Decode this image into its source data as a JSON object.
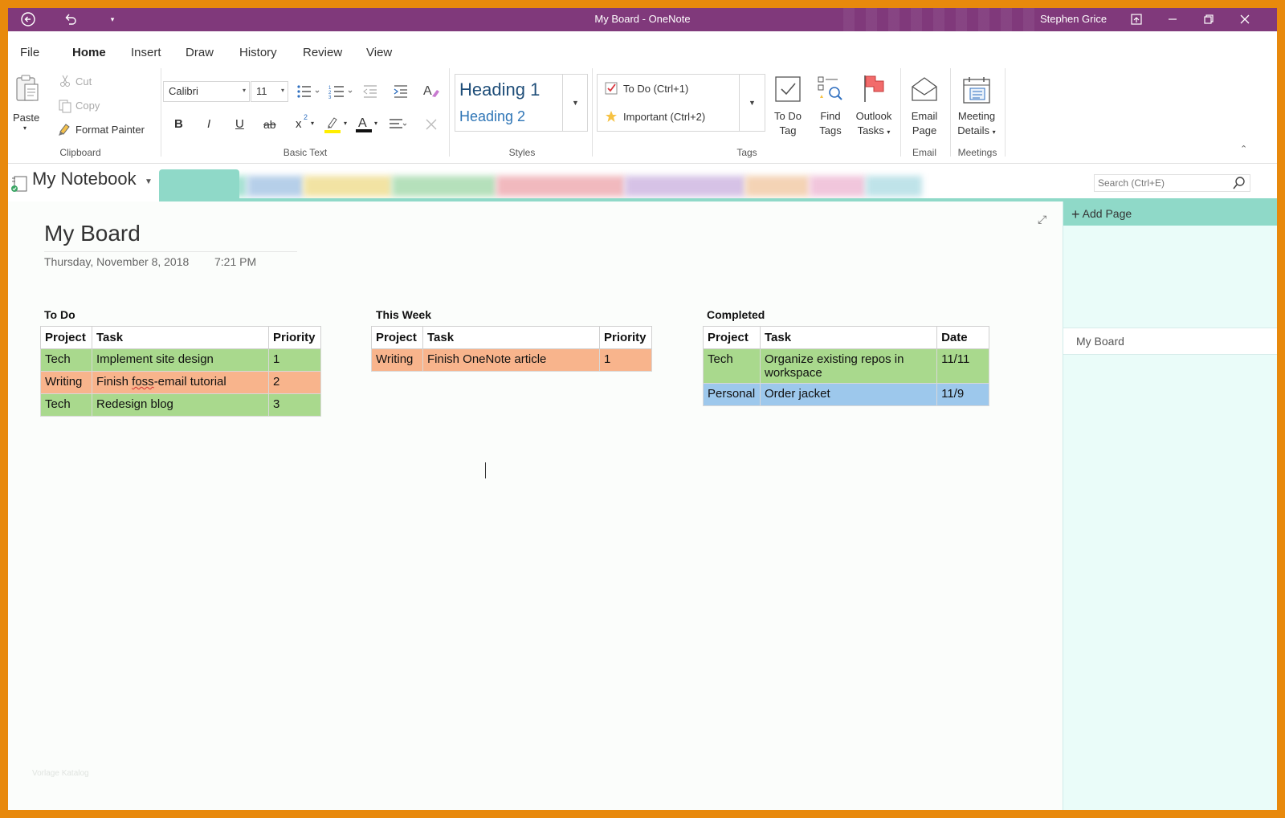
{
  "window": {
    "title": "My Board  -  OneNote",
    "user": "Stephen Grice"
  },
  "menu": {
    "tabs": [
      "File",
      "Home",
      "Insert",
      "Draw",
      "History",
      "Review",
      "View"
    ],
    "active": "Home"
  },
  "ribbon": {
    "clipboard": {
      "paste": "Paste",
      "cut": "Cut",
      "copy": "Copy",
      "format_painter": "Format Painter",
      "group": "Clipboard"
    },
    "basic_text": {
      "font": "Calibri",
      "size": "11",
      "group": "Basic Text",
      "bold": "B",
      "italic": "I",
      "underline": "U",
      "strike": "ab",
      "superscript": "x"
    },
    "styles": {
      "heading1": "Heading 1",
      "heading2": "Heading 2",
      "group": "Styles"
    },
    "tags": {
      "todo": "To Do (Ctrl+1)",
      "important": "Important (Ctrl+2)",
      "todo_tag_1": "To Do",
      "todo_tag_2": "Tag",
      "find_tags_1": "Find",
      "find_tags_2": "Tags",
      "outlook_1": "Outlook",
      "outlook_2": "Tasks",
      "group": "Tags"
    },
    "email": {
      "label_1": "Email",
      "label_2": "Page",
      "group": "Email"
    },
    "meetings": {
      "label_1": "Meeting",
      "label_2": "Details",
      "group": "Meetings"
    }
  },
  "notebook": {
    "name": "My Notebook",
    "search_placeholder": "Search (Ctrl+E)"
  },
  "page": {
    "title": "My Board",
    "date": "Thursday, November 8, 2018",
    "time": "7:21 PM",
    "watermark": "Vorlage Katalog"
  },
  "boards": {
    "todo": {
      "heading": "To Do",
      "columns": [
        "Project",
        "Task",
        "Priority"
      ],
      "rows": [
        {
          "project": "Tech",
          "task_pre": "Implement site design",
          "task_err": "",
          "task_post": "",
          "priority": "1",
          "color": "green"
        },
        {
          "project": "Writing",
          "task_pre": "Finish ",
          "task_err": "foss",
          "task_post": "-email tutorial",
          "priority": "2",
          "color": "orange"
        },
        {
          "project": "Tech",
          "task_pre": "Redesign blog",
          "task_err": "",
          "task_post": "",
          "priority": "3",
          "color": "green"
        }
      ]
    },
    "week": {
      "heading": "This Week",
      "columns": [
        "Project",
        "Task",
        "Priority"
      ],
      "rows": [
        {
          "project": "Writing",
          "task": "Finish OneNote article",
          "priority": "1",
          "color": "orange"
        }
      ]
    },
    "completed": {
      "heading": "Completed",
      "columns": [
        "Project",
        "Task",
        "Date"
      ],
      "rows": [
        {
          "project": "Tech",
          "task": "Organize existing repos in workspace",
          "date": "11/11",
          "color": "green"
        },
        {
          "project": "Personal",
          "task": "Order jacket",
          "date": "11/9",
          "color": "blue"
        }
      ]
    }
  },
  "pages_pane": {
    "add_page": "Add Page",
    "items": [
      "My Board"
    ]
  },
  "colors": {
    "onenote_purple": "#80397b",
    "section_teal": "#8fd9c8",
    "green": "#a9d98d",
    "orange": "#f8b48c",
    "blue": "#9dc8ec",
    "frame_orange": "#e8890c"
  },
  "icons": [
    "back-arrow-icon",
    "undo-icon",
    "quick-access-dropdown-icon",
    "fullscreen-icon",
    "minimize-icon",
    "restore-icon",
    "close-icon",
    "paste-icon",
    "cut-icon",
    "copy-icon",
    "format-painter-icon",
    "bullets-icon",
    "numbering-icon",
    "outdent-icon",
    "indent-icon",
    "clear-formatting-icon",
    "highlight-icon",
    "font-color-icon",
    "align-icon",
    "delete-icon",
    "todo-checkbox-icon",
    "star-icon",
    "todo-tag-icon",
    "find-tags-icon",
    "outlook-flag-icon",
    "email-page-icon",
    "meeting-details-icon",
    "collapse-ribbon-icon",
    "notebook-icon",
    "search-icon",
    "expand-icon",
    "plus-icon"
  ]
}
